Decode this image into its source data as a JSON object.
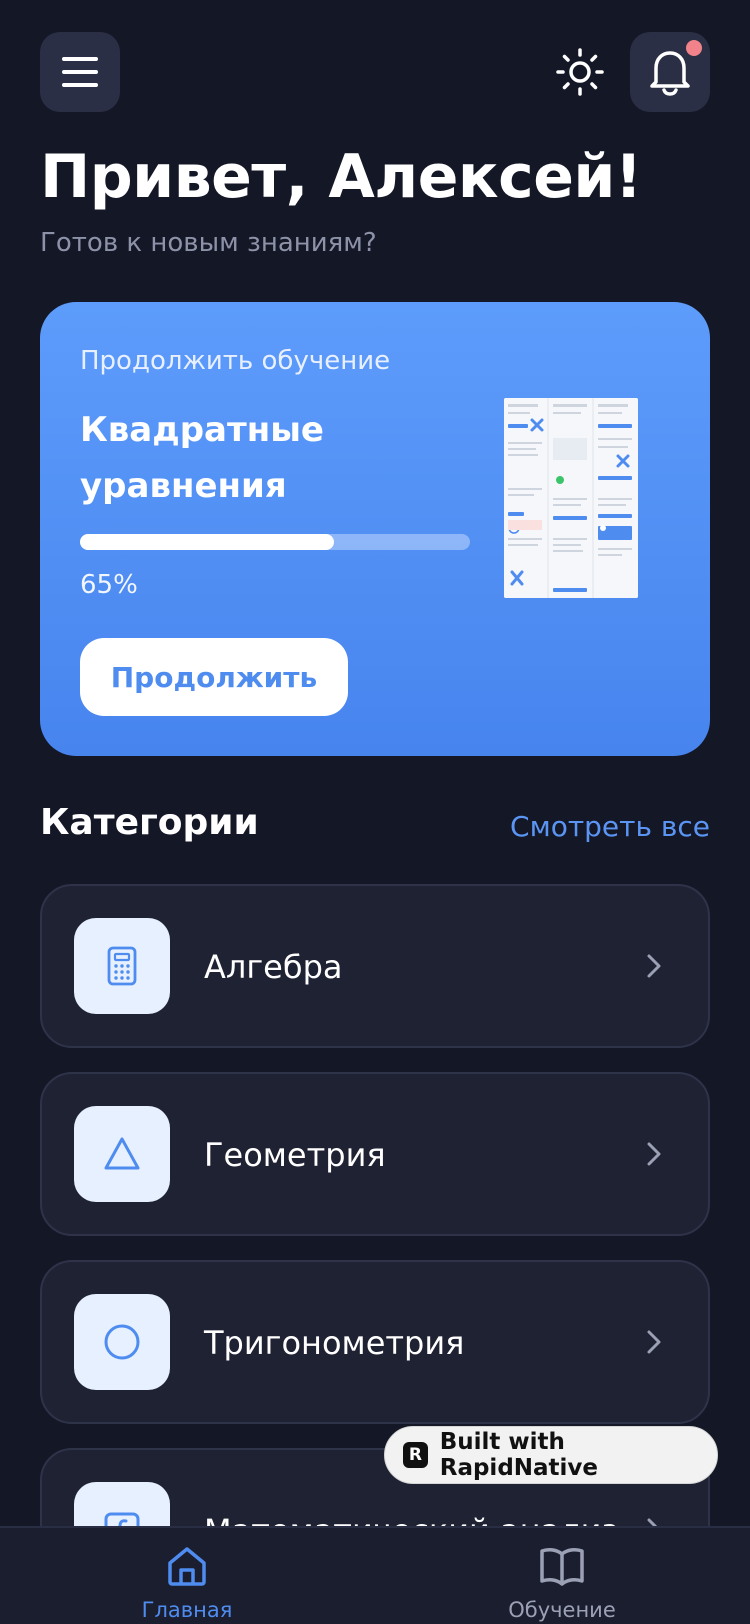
{
  "header": {
    "greeting": "Привет, Алексей!",
    "subtitle": "Готов к новым знаниям?"
  },
  "continue_card": {
    "kicker": "Продолжить обучение",
    "title": "Квадратные уравнения",
    "progress": 0.65,
    "progress_label": "65%",
    "button_label": "Продолжить"
  },
  "categories": {
    "title": "Категории",
    "see_all": "Смотреть все",
    "items": [
      {
        "label": "Алгебра",
        "icon": "calculator-icon"
      },
      {
        "label": "Геометрия",
        "icon": "triangle-icon"
      },
      {
        "label": "Тригонометрия",
        "icon": "circle-icon"
      },
      {
        "label": "Математический анализ",
        "icon": "function-icon"
      }
    ]
  },
  "badge": {
    "label": "Built with RapidNative"
  },
  "tabbar": {
    "items": [
      {
        "label": "Главная",
        "icon": "home-icon",
        "active": true
      },
      {
        "label": "Обучение",
        "icon": "book-icon",
        "active": false
      }
    ]
  },
  "colors": {
    "background": "#141726",
    "accent": "#5b95f4",
    "card": "#1f2233",
    "notification_dot": "#f2838a"
  }
}
